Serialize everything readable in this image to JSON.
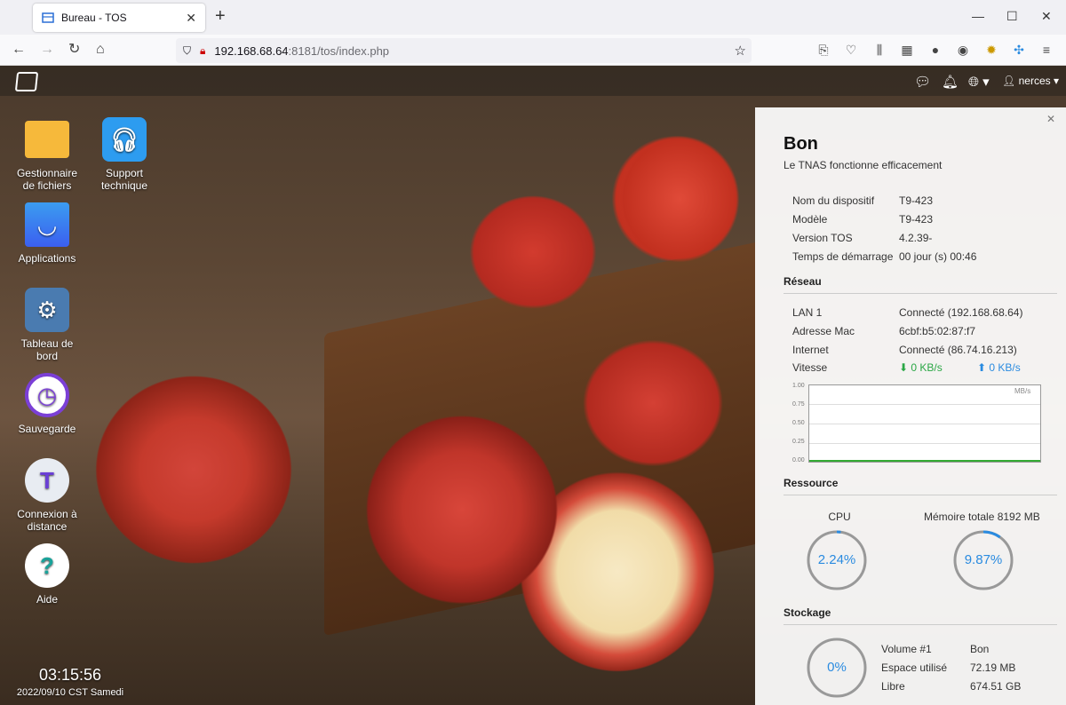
{
  "browser": {
    "tab_title": "Bureau - TOS",
    "url_host": "192.168.68.64",
    "url_path": ":8181/tos/index.php"
  },
  "desktop": {
    "user": "nerces",
    "icons": [
      {
        "label": "Gestionnaire de fichiers",
        "icon": "folder-icon",
        "color": "#f6b93b"
      },
      {
        "label": "Support technique",
        "icon": "headset-icon",
        "color": "#2d9cf0"
      },
      {
        "label": "Applications",
        "icon": "shopping-bag-icon",
        "color": "#3b7ff0"
      },
      {
        "label": "Tableau de bord",
        "icon": "gear-icon",
        "color": "#4a7bb0"
      },
      {
        "label": "Sauvegarde",
        "icon": "backup-clock-icon",
        "color": "#7b3fd6"
      },
      {
        "label": "Connexion à distance",
        "icon": "cloud-t-icon",
        "color": "#e8ecf2"
      },
      {
        "label": "Aide",
        "icon": "help-icon",
        "color": "#ffffff"
      }
    ],
    "clock_time": "03:15:56",
    "clock_date": "2022/09/10 CST Samedi"
  },
  "panel": {
    "status": "Bon",
    "status_desc": "Le TNAS fonctionne efficacement",
    "device": [
      {
        "k": "Nom du dispositif",
        "v": "T9-423"
      },
      {
        "k": "Modèle",
        "v": "T9-423"
      },
      {
        "k": "Version TOS",
        "v": "4.2.39-"
      },
      {
        "k": "Temps de démarrage",
        "v": "00 jour (s) 00:46"
      }
    ],
    "network_title": "Réseau",
    "network": [
      {
        "k": "LAN 1",
        "v": "Connecté (192.168.68.64)"
      },
      {
        "k": "Adresse Mac",
        "v": "6cbf:b5:02:87:f7"
      },
      {
        "k": "Internet",
        "v": "Connecté (86.74.16.213)"
      }
    ],
    "speed_label": "Vitesse",
    "speed_down": "0 KB/s",
    "speed_up": "0 KB/s",
    "graph_unit": "MB/s",
    "graph_ticks": [
      "1.00",
      "0.75",
      "0.50",
      "0.25",
      "0.00"
    ],
    "resource_title": "Ressource",
    "cpu_label": "CPU",
    "cpu_value": "2.24%",
    "cpu_fraction": 0.0224,
    "mem_label": "Mémoire totale 8192 MB",
    "mem_value": "9.87%",
    "mem_fraction": 0.0987,
    "storage_title": "Stockage",
    "volume_percent": "0%",
    "volume": [
      {
        "k": "Volume #1",
        "v": "Bon"
      },
      {
        "k": "Espace utilisé",
        "v": "72.19 MB"
      },
      {
        "k": "Libre",
        "v": "674.51 GB"
      }
    ]
  }
}
